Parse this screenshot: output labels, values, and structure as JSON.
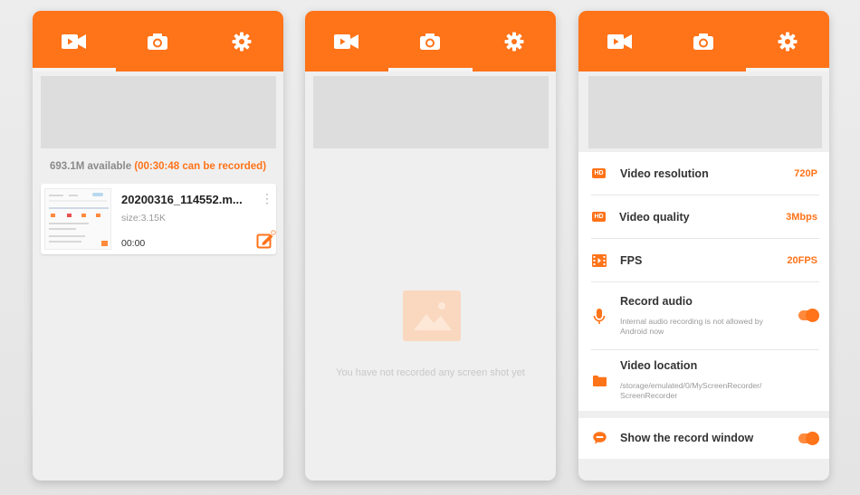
{
  "colors": {
    "accent": "#ff7319",
    "panel_bg": "#efefef",
    "banner": "#dddddd"
  },
  "tabs": [
    {
      "name": "video-tab",
      "icon": "video-camera-icon"
    },
    {
      "name": "screenshot-tab",
      "icon": "photo-camera-icon"
    },
    {
      "name": "settings-tab",
      "icon": "gear-icon"
    }
  ],
  "recordings": {
    "storage_available": "693.1M available",
    "storage_recordable": "(00:30:48 can be recorded)",
    "files": [
      {
        "name": "20200316_114552.m...",
        "size": "size:3.15K",
        "duration": "00:00"
      }
    ]
  },
  "screenshots": {
    "empty_message": "You have not recorded any screen shot yet"
  },
  "settings": {
    "video_resolution": {
      "label": "Video resolution",
      "value": "720P",
      "icon": "hd-icon"
    },
    "video_quality": {
      "label": "Video quality",
      "value": "3Mbps",
      "icon": "hd-icon"
    },
    "fps": {
      "label": "FPS",
      "value": "20FPS",
      "icon": "film-icon"
    },
    "record_audio": {
      "label": "Record audio",
      "subtitle": "Internal audio recording is not allowed by Android now",
      "icon": "microphone-icon",
      "enabled": true
    },
    "video_location": {
      "label": "Video location",
      "path": "/storage/emulated/0/MyScreenRecorder/ ScreenRecorder",
      "icon": "folder-icon"
    },
    "record_window": {
      "label": "Show the record window",
      "icon": "chat-bubble-icon",
      "enabled": true
    }
  }
}
